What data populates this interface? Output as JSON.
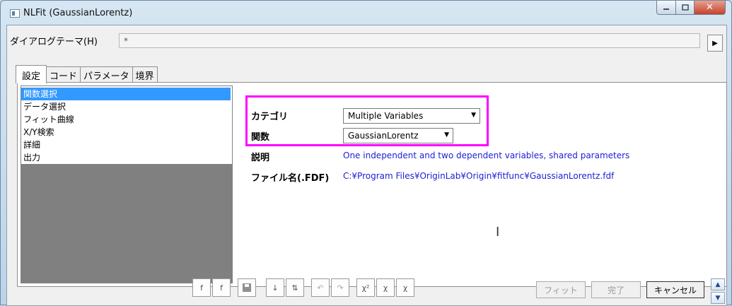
{
  "window": {
    "title": "NLFit (GaussianLorentz)"
  },
  "theme": {
    "label": "ダイアログテーマ(H)",
    "value": "*"
  },
  "tabs": [
    {
      "label": "設定"
    },
    {
      "label": "コード"
    },
    {
      "label": "パラメータ"
    },
    {
      "label": "境界"
    }
  ],
  "left_list": {
    "items": [
      {
        "label": "関数選択"
      },
      {
        "label": "データ選択"
      },
      {
        "label": "フィット曲線"
      },
      {
        "label": "X/Y検索"
      },
      {
        "label": "詳細"
      },
      {
        "label": "出力"
      }
    ]
  },
  "settings": {
    "category_label": "カテゴリ",
    "category_value": "Multiple Variables",
    "function_label": "関数",
    "function_value": "GaussianLorentz",
    "description_label": "説明",
    "description_value": "One independent and two dependent variables, shared parameters",
    "file_label": "ファイル名(.FDF)",
    "file_value": "C:¥Program Files¥OriginLab¥Origin¥fitfunc¥GaussianLorentz.fdf"
  },
  "buttons": {
    "fit": "フィット",
    "done": "完了",
    "cancel": "キャンセル"
  },
  "colors": {
    "highlight": "#ff00ff",
    "link": "#2020d8",
    "selection": "#3399ff"
  }
}
